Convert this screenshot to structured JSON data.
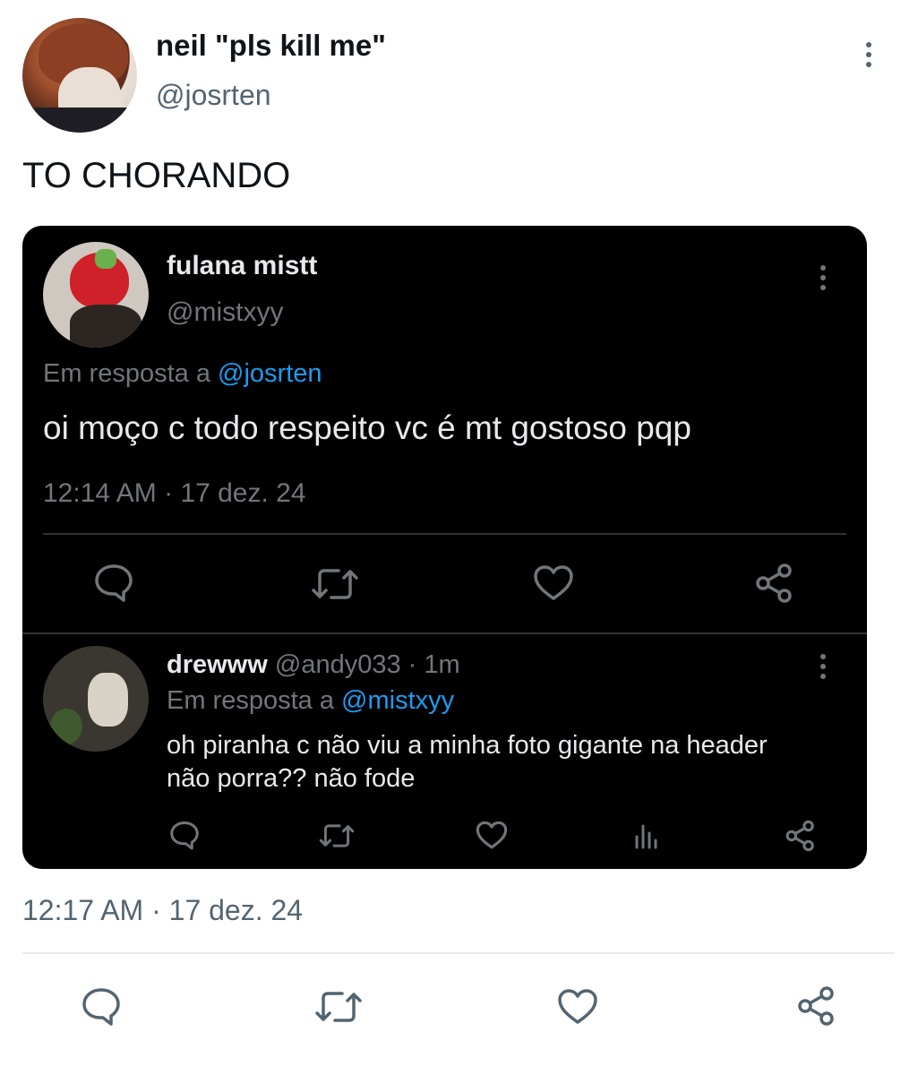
{
  "tweet": {
    "author": {
      "name": "neil \"pls kill me\"",
      "handle": "@josrten"
    },
    "text": "TO CHORANDO",
    "timestamp": "12:17 AM · 17 dez. 24",
    "actions": [
      {
        "name": "reply",
        "icon": "reply-icon"
      },
      {
        "name": "retweet",
        "icon": "retweet-icon"
      },
      {
        "name": "like",
        "icon": "heart-icon"
      },
      {
        "name": "share",
        "icon": "share-icon"
      }
    ]
  },
  "quoted_tweet": {
    "author": {
      "name": "fulana mistt",
      "handle": "@mistxyy"
    },
    "reply_prefix": "Em resposta a",
    "reply_to": "@josrten",
    "text": "oi moço c todo respeito vc é mt gostoso pqp",
    "timestamp": "12:14 AM · 17 dez. 24"
  },
  "reply_tweet": {
    "author": {
      "name": "drewww",
      "handle_time": "@andy033 · 1m"
    },
    "reply_prefix": "Em resposta a",
    "reply_to": "@mistxyy",
    "text_line1": "oh piranha c não viu a minha foto gigante na header",
    "text_line2": "não porra?? não fode"
  },
  "colors": {
    "link": "#1d9bf0",
    "dark_bg": "#000000",
    "dark_secondary": "#71767b",
    "light_secondary": "#536471",
    "icon_light": "#536471",
    "icon_dark": "#71767b"
  }
}
